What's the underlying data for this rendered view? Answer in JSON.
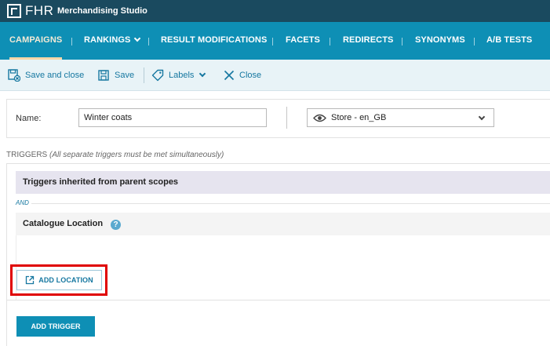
{
  "header": {
    "logo": "FHR",
    "app_title": "Merchandising Studio"
  },
  "nav": {
    "items": [
      {
        "label": "CAMPAIGNS",
        "active": true
      },
      {
        "label": "RANKINGS",
        "dropdown": true
      },
      {
        "label": "RESULT MODIFICATIONS"
      },
      {
        "label": "FACETS"
      },
      {
        "label": "REDIRECTS"
      },
      {
        "label": "SYNONYMS"
      },
      {
        "label": "A/B TESTS"
      }
    ]
  },
  "toolbar": {
    "save_close_label": "Save and close",
    "save_label": "Save",
    "labels_label": "Labels",
    "close_label": "Close"
  },
  "form": {
    "name_label": "Name:",
    "name_value": "Winter coats",
    "store_value": "Store - en_GB"
  },
  "triggers": {
    "heading": "TRIGGERS",
    "heading_note": "(All separate triggers must be met simultaneously)",
    "inherited_label": "Triggers inherited from parent scopes",
    "and_label": "AND",
    "catalogue_location_label": "Catalogue Location",
    "add_location_label": "ADD LOCATION",
    "add_trigger_label": "ADD TRIGGER"
  },
  "colors": {
    "topbar": "#1a4a5f",
    "navbar": "#0e8fb5",
    "highlight": "#e00000"
  }
}
